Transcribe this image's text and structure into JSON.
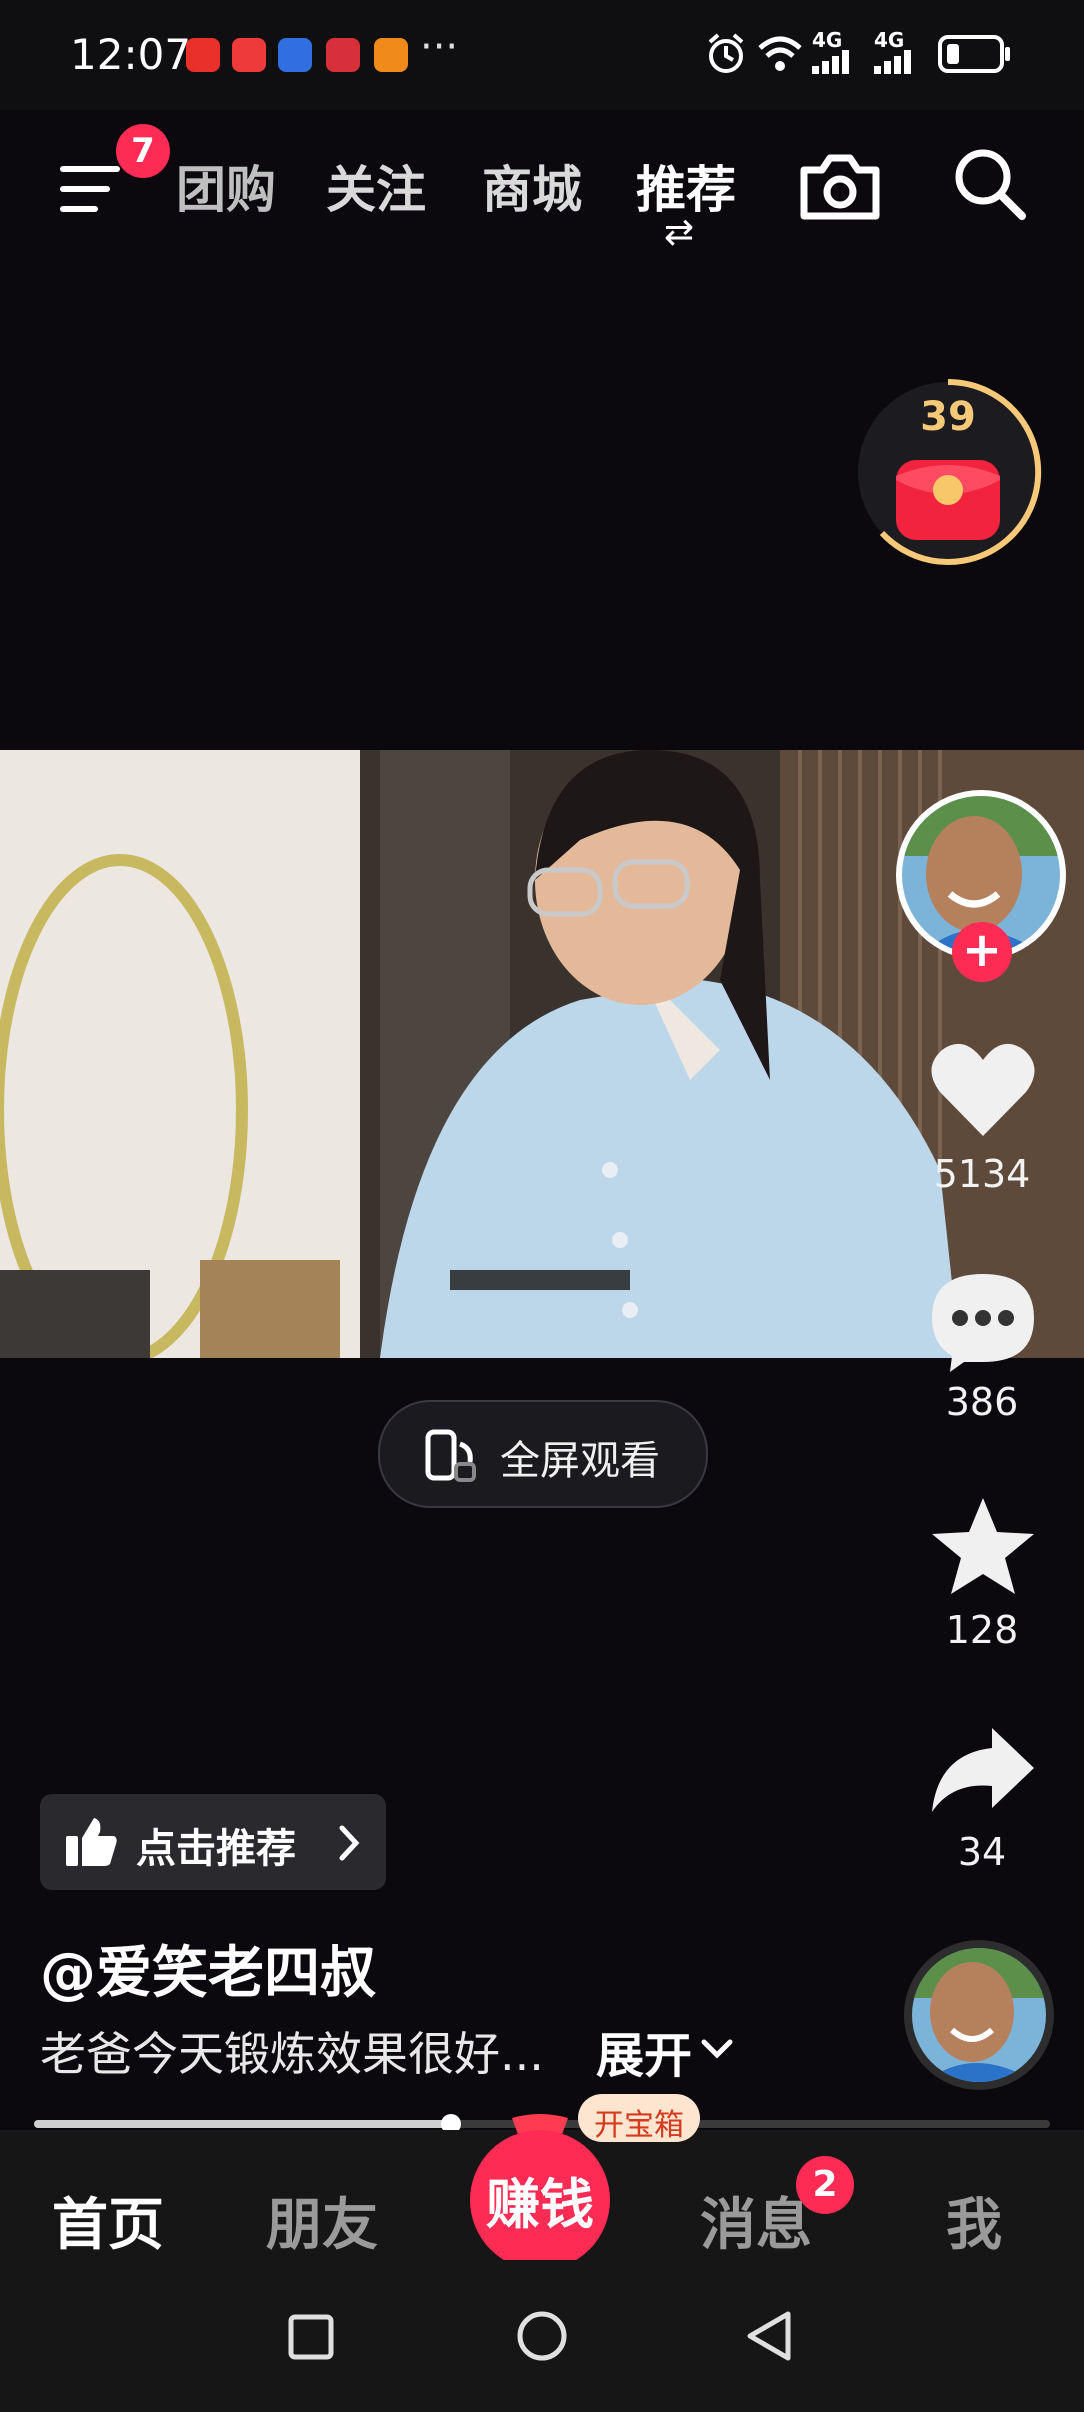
{
  "status_bar": {
    "time": "12:07",
    "more": "···",
    "network_1": "4G",
    "network_2": "4G",
    "app_icons": [
      "toutiao-icon",
      "red-book-icon",
      "blue-app-icon",
      "game-app-icon",
      "orange-app-icon"
    ]
  },
  "top_nav": {
    "menu_badge": "7",
    "tabs": [
      {
        "label": "团购"
      },
      {
        "label": "关注"
      },
      {
        "label": "商城"
      },
      {
        "label": "推荐"
      }
    ],
    "active_tab_indicator": "⇄"
  },
  "reward_timer": {
    "count": "39"
  },
  "video": {
    "fullscreen_label": "全屏观看"
  },
  "right_rail": {
    "like_count": "5134",
    "comment_count": "386",
    "favorite_count": "128",
    "share_count": "34"
  },
  "recommend_chip": {
    "label": "点击推荐"
  },
  "author": {
    "handle": "@爱笑老四叔"
  },
  "caption": {
    "text": "老爸今天锻炼效果很好...",
    "expand_label": "展开"
  },
  "progress": {
    "played_fraction": 0.41
  },
  "bottom_nav": {
    "home": "首页",
    "friends": "朋友",
    "earn": "赚钱",
    "earn_tag": "开宝箱",
    "messages": "消息",
    "messages_badge": "2",
    "me": "我"
  },
  "colors": {
    "accent": "#fe2c55",
    "background": "#0b090e",
    "gold": "#f5c978"
  }
}
